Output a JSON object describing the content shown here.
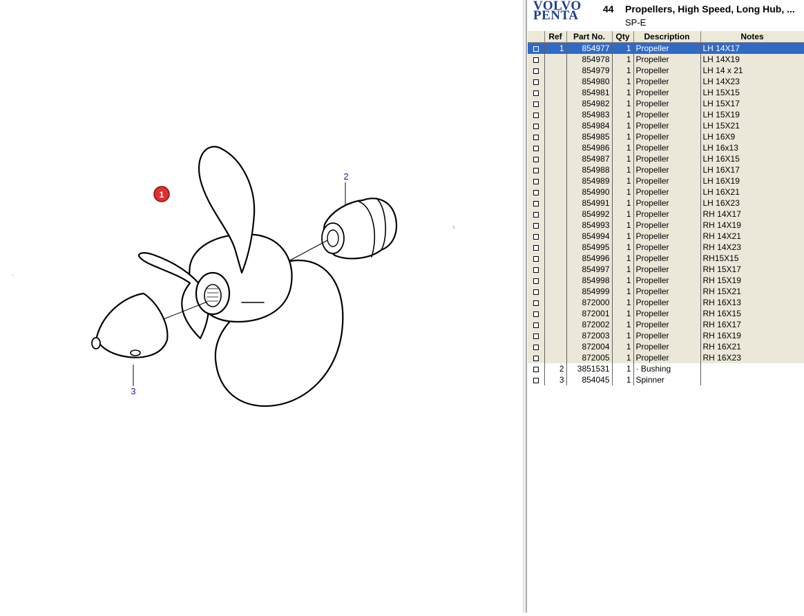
{
  "diagram": {
    "callouts": {
      "ref1": "1",
      "ref2": "2",
      "ref3": "3"
    }
  },
  "header": {
    "logo_line1": "VOLVO",
    "logo_line2": "PENTA",
    "group_number": "44",
    "group_title": "Propellers, High Speed, Long Hub, ...",
    "group_subtitle": "SP-E",
    "logo_color": "#1f3e8c"
  },
  "table": {
    "columns": [
      "",
      "Ref",
      "Part No.",
      "Qty",
      "Description",
      "Notes"
    ],
    "rows": [
      {
        "ref": "1",
        "part": "854977",
        "qty": "1",
        "desc": "Propeller",
        "notes": "LH 14X17"
      },
      {
        "ref": "",
        "part": "854978",
        "qty": "1",
        "desc": "Propeller",
        "notes": "LH 14X19"
      },
      {
        "ref": "",
        "part": "854979",
        "qty": "1",
        "desc": "Propeller",
        "notes": "LH 14 x 21"
      },
      {
        "ref": "",
        "part": "854980",
        "qty": "1",
        "desc": "Propeller",
        "notes": "LH 14X23"
      },
      {
        "ref": "",
        "part": "854981",
        "qty": "1",
        "desc": "Propeller",
        "notes": "LH 15X15"
      },
      {
        "ref": "",
        "part": "854982",
        "qty": "1",
        "desc": "Propeller",
        "notes": "LH 15X17"
      },
      {
        "ref": "",
        "part": "854983",
        "qty": "1",
        "desc": "Propeller",
        "notes": "LH 15X19"
      },
      {
        "ref": "",
        "part": "854984",
        "qty": "1",
        "desc": "Propeller",
        "notes": "LH 15X21"
      },
      {
        "ref": "",
        "part": "854985",
        "qty": "1",
        "desc": "Propeller",
        "notes": "LH 16X9"
      },
      {
        "ref": "",
        "part": "854986",
        "qty": "1",
        "desc": "Propeller",
        "notes": "LH 16x13"
      },
      {
        "ref": "",
        "part": "854987",
        "qty": "1",
        "desc": "Propeller",
        "notes": "LH 16X15"
      },
      {
        "ref": "",
        "part": "854988",
        "qty": "1",
        "desc": "Propeller",
        "notes": "LH 16X17"
      },
      {
        "ref": "",
        "part": "854989",
        "qty": "1",
        "desc": "Propeller",
        "notes": "LH 16X19"
      },
      {
        "ref": "",
        "part": "854990",
        "qty": "1",
        "desc": "Propeller",
        "notes": "LH 16X21"
      },
      {
        "ref": "",
        "part": "854991",
        "qty": "1",
        "desc": "Propeller",
        "notes": "LH 16X23"
      },
      {
        "ref": "",
        "part": "854992",
        "qty": "1",
        "desc": "Propeller",
        "notes": "RH 14X17"
      },
      {
        "ref": "",
        "part": "854993",
        "qty": "1",
        "desc": "Propeller",
        "notes": "RH 14X19"
      },
      {
        "ref": "",
        "part": "854994",
        "qty": "1",
        "desc": "Propeller",
        "notes": "RH 14X21"
      },
      {
        "ref": "",
        "part": "854995",
        "qty": "1",
        "desc": "Propeller",
        "notes": "RH 14X23"
      },
      {
        "ref": "",
        "part": "854996",
        "qty": "1",
        "desc": "Propeller",
        "notes": "RH15X15"
      },
      {
        "ref": "",
        "part": "854997",
        "qty": "1",
        "desc": "Propeller",
        "notes": "RH 15X17"
      },
      {
        "ref": "",
        "part": "854998",
        "qty": "1",
        "desc": "Propeller",
        "notes": "RH 15X19"
      },
      {
        "ref": "",
        "part": "854999",
        "qty": "1",
        "desc": "Propeller",
        "notes": "RH 15X21"
      },
      {
        "ref": "",
        "part": "872000",
        "qty": "1",
        "desc": "Propeller",
        "notes": "RH 16X13"
      },
      {
        "ref": "",
        "part": "872001",
        "qty": "1",
        "desc": "Propeller",
        "notes": "RH 16X15"
      },
      {
        "ref": "",
        "part": "872002",
        "qty": "1",
        "desc": "Propeller",
        "notes": "RH 16X17"
      },
      {
        "ref": "",
        "part": "872003",
        "qty": "1",
        "desc": "Propeller",
        "notes": "RH 16X19"
      },
      {
        "ref": "",
        "part": "872004",
        "qty": "1",
        "desc": "Propeller",
        "notes": "RH 16X21"
      },
      {
        "ref": "",
        "part": "872005",
        "qty": "1",
        "desc": "Propeller",
        "notes": "RH 16X23"
      },
      {
        "ref": "2",
        "part": "3851531",
        "qty": "1",
        "desc": "· Bushing",
        "notes": ""
      },
      {
        "ref": "3",
        "part": "854045",
        "qty": "1",
        "desc": "Spinner",
        "notes": ""
      }
    ]
  },
  "colors": {
    "selected_row": "#316ac5",
    "propeller_row": "#ebe7d9",
    "callout_badge": "#e03030",
    "callout_text": "#1a1aa0"
  }
}
